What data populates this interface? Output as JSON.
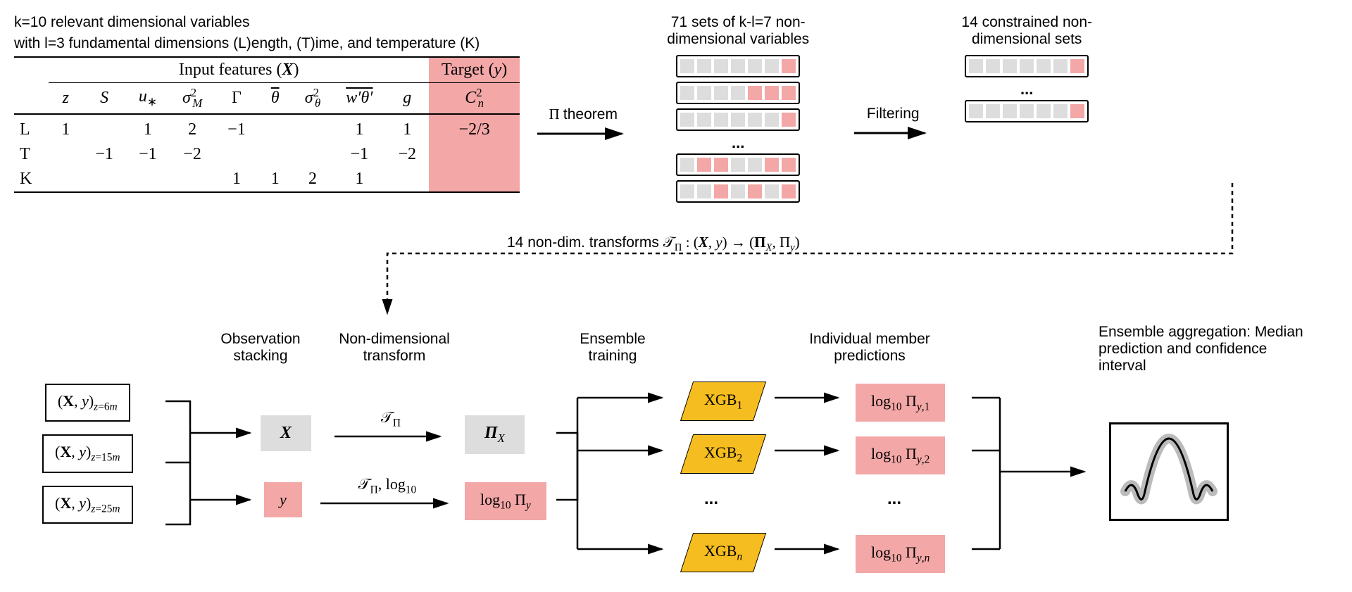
{
  "header": {
    "line1": "k=10 relevant dimensional variables",
    "line2": "with l=3 fundamental dimensions (L)ength, (T)ime, and temperature (K)"
  },
  "table": {
    "input_header": "Input features (𝑿)",
    "target_header": "Target (𝑦)",
    "columns": [
      "z",
      "S",
      "u∗",
      "σ²_M",
      "Γ",
      "θ̄",
      "σ²_θ",
      "w′θ′",
      "g"
    ],
    "target_col": "C²_n",
    "rows": [
      {
        "label": "L",
        "vals": [
          "1",
          "",
          "1",
          "2",
          "−1",
          "",
          "",
          "1",
          "1"
        ],
        "target": "−2/3"
      },
      {
        "label": "T",
        "vals": [
          "",
          "−1",
          "−1",
          "−2",
          "",
          "",
          "",
          "−1",
          "−2"
        ],
        "target": ""
      },
      {
        "label": "K",
        "vals": [
          "",
          "",
          "",
          "",
          "1",
          "1",
          "2",
          "1",
          ""
        ],
        "target": ""
      }
    ]
  },
  "arrows": {
    "pi_theorem": "Π theorem",
    "filtering": "Filtering"
  },
  "sets71": {
    "header": "71 sets of k-l=7 non-dimensional variables"
  },
  "sets14": {
    "header": "14 constrained non-dimensional sets"
  },
  "transform_line": "14 non-dim. transforms 𝒯_Π : (𝑿, 𝑦) → (Π_X, Π_y)",
  "pipeline": {
    "stage_obs": "Observation stacking",
    "stage_transform": "Non-dimensional transform",
    "stage_train": "Ensemble training",
    "stage_pred": "Individual member predictions",
    "stage_agg": "Ensemble aggregation: Median prediction and confidence interval",
    "obs_boxes": [
      "(X, y)_{z=6m}",
      "(X, y)_{z=15m}",
      "(X, y)_{z=25m}"
    ],
    "X_box": "X",
    "y_box": "y",
    "t_label_top": "𝒯_Π",
    "t_label_bot": "𝒯_Π, log₁₀",
    "PiX_box": "Π_X",
    "Piy_box": "log₁₀ Π_y",
    "xgb": [
      "XGB₁",
      "XGB₂",
      "XGBₙ"
    ],
    "preds": [
      "log₁₀ Π_{y,1}",
      "log₁₀ Π_{y,2}",
      "log₁₀ Π_{y,n}"
    ],
    "ellipsis": "..."
  }
}
